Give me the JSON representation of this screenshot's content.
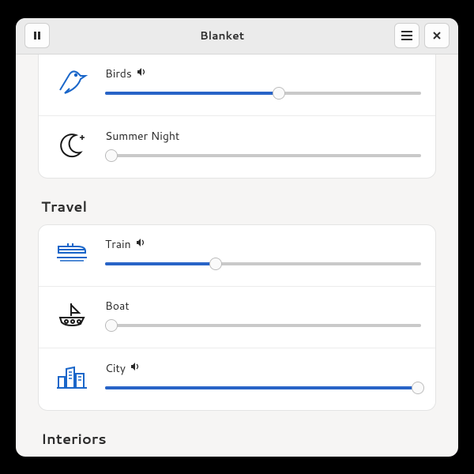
{
  "app": {
    "title": "Blanket"
  },
  "groups": [
    {
      "title": null,
      "cut_top": true,
      "rows": [
        {
          "icon": "bird-icon",
          "label": "Birds",
          "playing": true,
          "value": 55
        },
        {
          "icon": "moon-icon",
          "label": "Summer Night",
          "playing": false,
          "value": 2
        }
      ]
    },
    {
      "title": "Travel",
      "cut_top": false,
      "rows": [
        {
          "icon": "train-icon",
          "label": "Train",
          "playing": true,
          "value": 35
        },
        {
          "icon": "boat-icon",
          "label": "Boat",
          "playing": false,
          "value": 2
        },
        {
          "icon": "city-icon",
          "label": "City",
          "playing": true,
          "value": 99
        }
      ]
    },
    {
      "title": "Interiors",
      "cut_top": false,
      "rows": []
    }
  ]
}
